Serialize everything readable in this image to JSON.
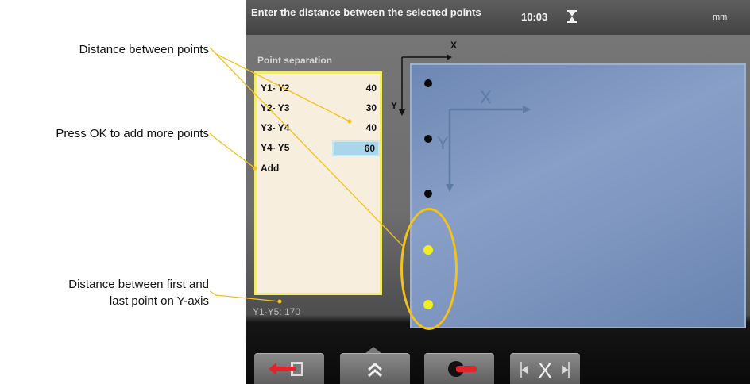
{
  "callouts": {
    "distance_between_points": "Distance between points",
    "press_ok": "Press OK to add more points",
    "first_last_line1": "Distance between first and",
    "first_last_line2": "last point on Y-axis"
  },
  "topbar": {
    "prompt": "Enter the distance between the selected points",
    "time": "10:03",
    "unit": "mm"
  },
  "panel": {
    "title": "Point separation",
    "rows": [
      {
        "label": "Y1- Y2",
        "value": "40"
      },
      {
        "label": "Y2- Y3",
        "value": "30"
      },
      {
        "label": "Y3- Y4",
        "value": "40"
      },
      {
        "label": "Y4- Y5",
        "value": "60"
      }
    ],
    "selected_index": 3,
    "add_label": "Add",
    "summary": "Y1-Y5: 170"
  },
  "axes": {
    "x_label": "X",
    "y_label": "Y"
  },
  "points": {
    "count": 5,
    "selected": [
      4,
      5
    ]
  },
  "toolbar": {
    "buttons": [
      {
        "icon": "exit-icon"
      },
      {
        "icon": "chevron-up-icon"
      },
      {
        "icon": "measure-toggle-icon"
      },
      {
        "icon": "x-distance-icon"
      }
    ]
  },
  "colors": {
    "highlight": "#f5c11a",
    "selected_point": "#f3ee1e",
    "panel_border": "#f1ec6a",
    "selection": "#aad6ea"
  }
}
